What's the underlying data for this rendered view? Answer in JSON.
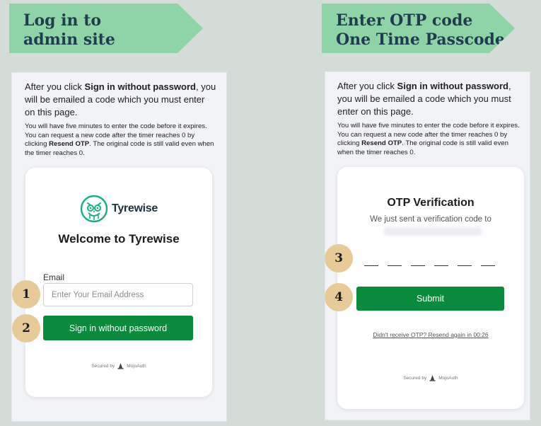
{
  "left_banner": {
    "line1": "Log in to",
    "line2": "admin site"
  },
  "right_banner": {
    "line1": "Enter OTP code",
    "line2": "One Time Passcode"
  },
  "instructions": {
    "p1_before": "After you click ",
    "p1_bold": "Sign in without password",
    "p1_after": ", you will be emailed a code which you must enter on this page.",
    "p2_before": "You will have five minutes to enter the code before it expires. You can request a new code after the timer reaches 0 by clicking ",
    "p2_bold": "Resend OTP",
    "p2_after": ". The original code is still valid even when the timer reaches 0."
  },
  "login_card": {
    "brand": "Tyrewise",
    "welcome": "Welcome to Tyrewise",
    "email_label": "Email",
    "email_placeholder": "Enter Your Email Address",
    "email_value": "",
    "signin_button": "Sign in without password",
    "secured_prefix": "Secured by",
    "secured_brand": "MojoAuth"
  },
  "otp_card": {
    "title": "OTP Verification",
    "subtitle": "We just sent a verification code to",
    "otp_digits": [
      "",
      "",
      "",
      "",
      "",
      ""
    ],
    "submit_button": "Submit",
    "resend_text": "Didn't receive OTP? Resend again in  00:26",
    "secured_prefix": "Secured by",
    "secured_brand": "MojoAuth"
  },
  "steps": [
    "1",
    "2",
    "3",
    "4"
  ],
  "colors": {
    "background": "#d3dcd7",
    "banner": "#8fd4a7",
    "banner_text": "#1f3d4f",
    "button": "#0b8a3d",
    "step_badge": "#e6ca97",
    "logo": "#18b07e"
  },
  "icons": {
    "logo": "owl-logo-icon",
    "secured": "wizard-hat-icon"
  }
}
